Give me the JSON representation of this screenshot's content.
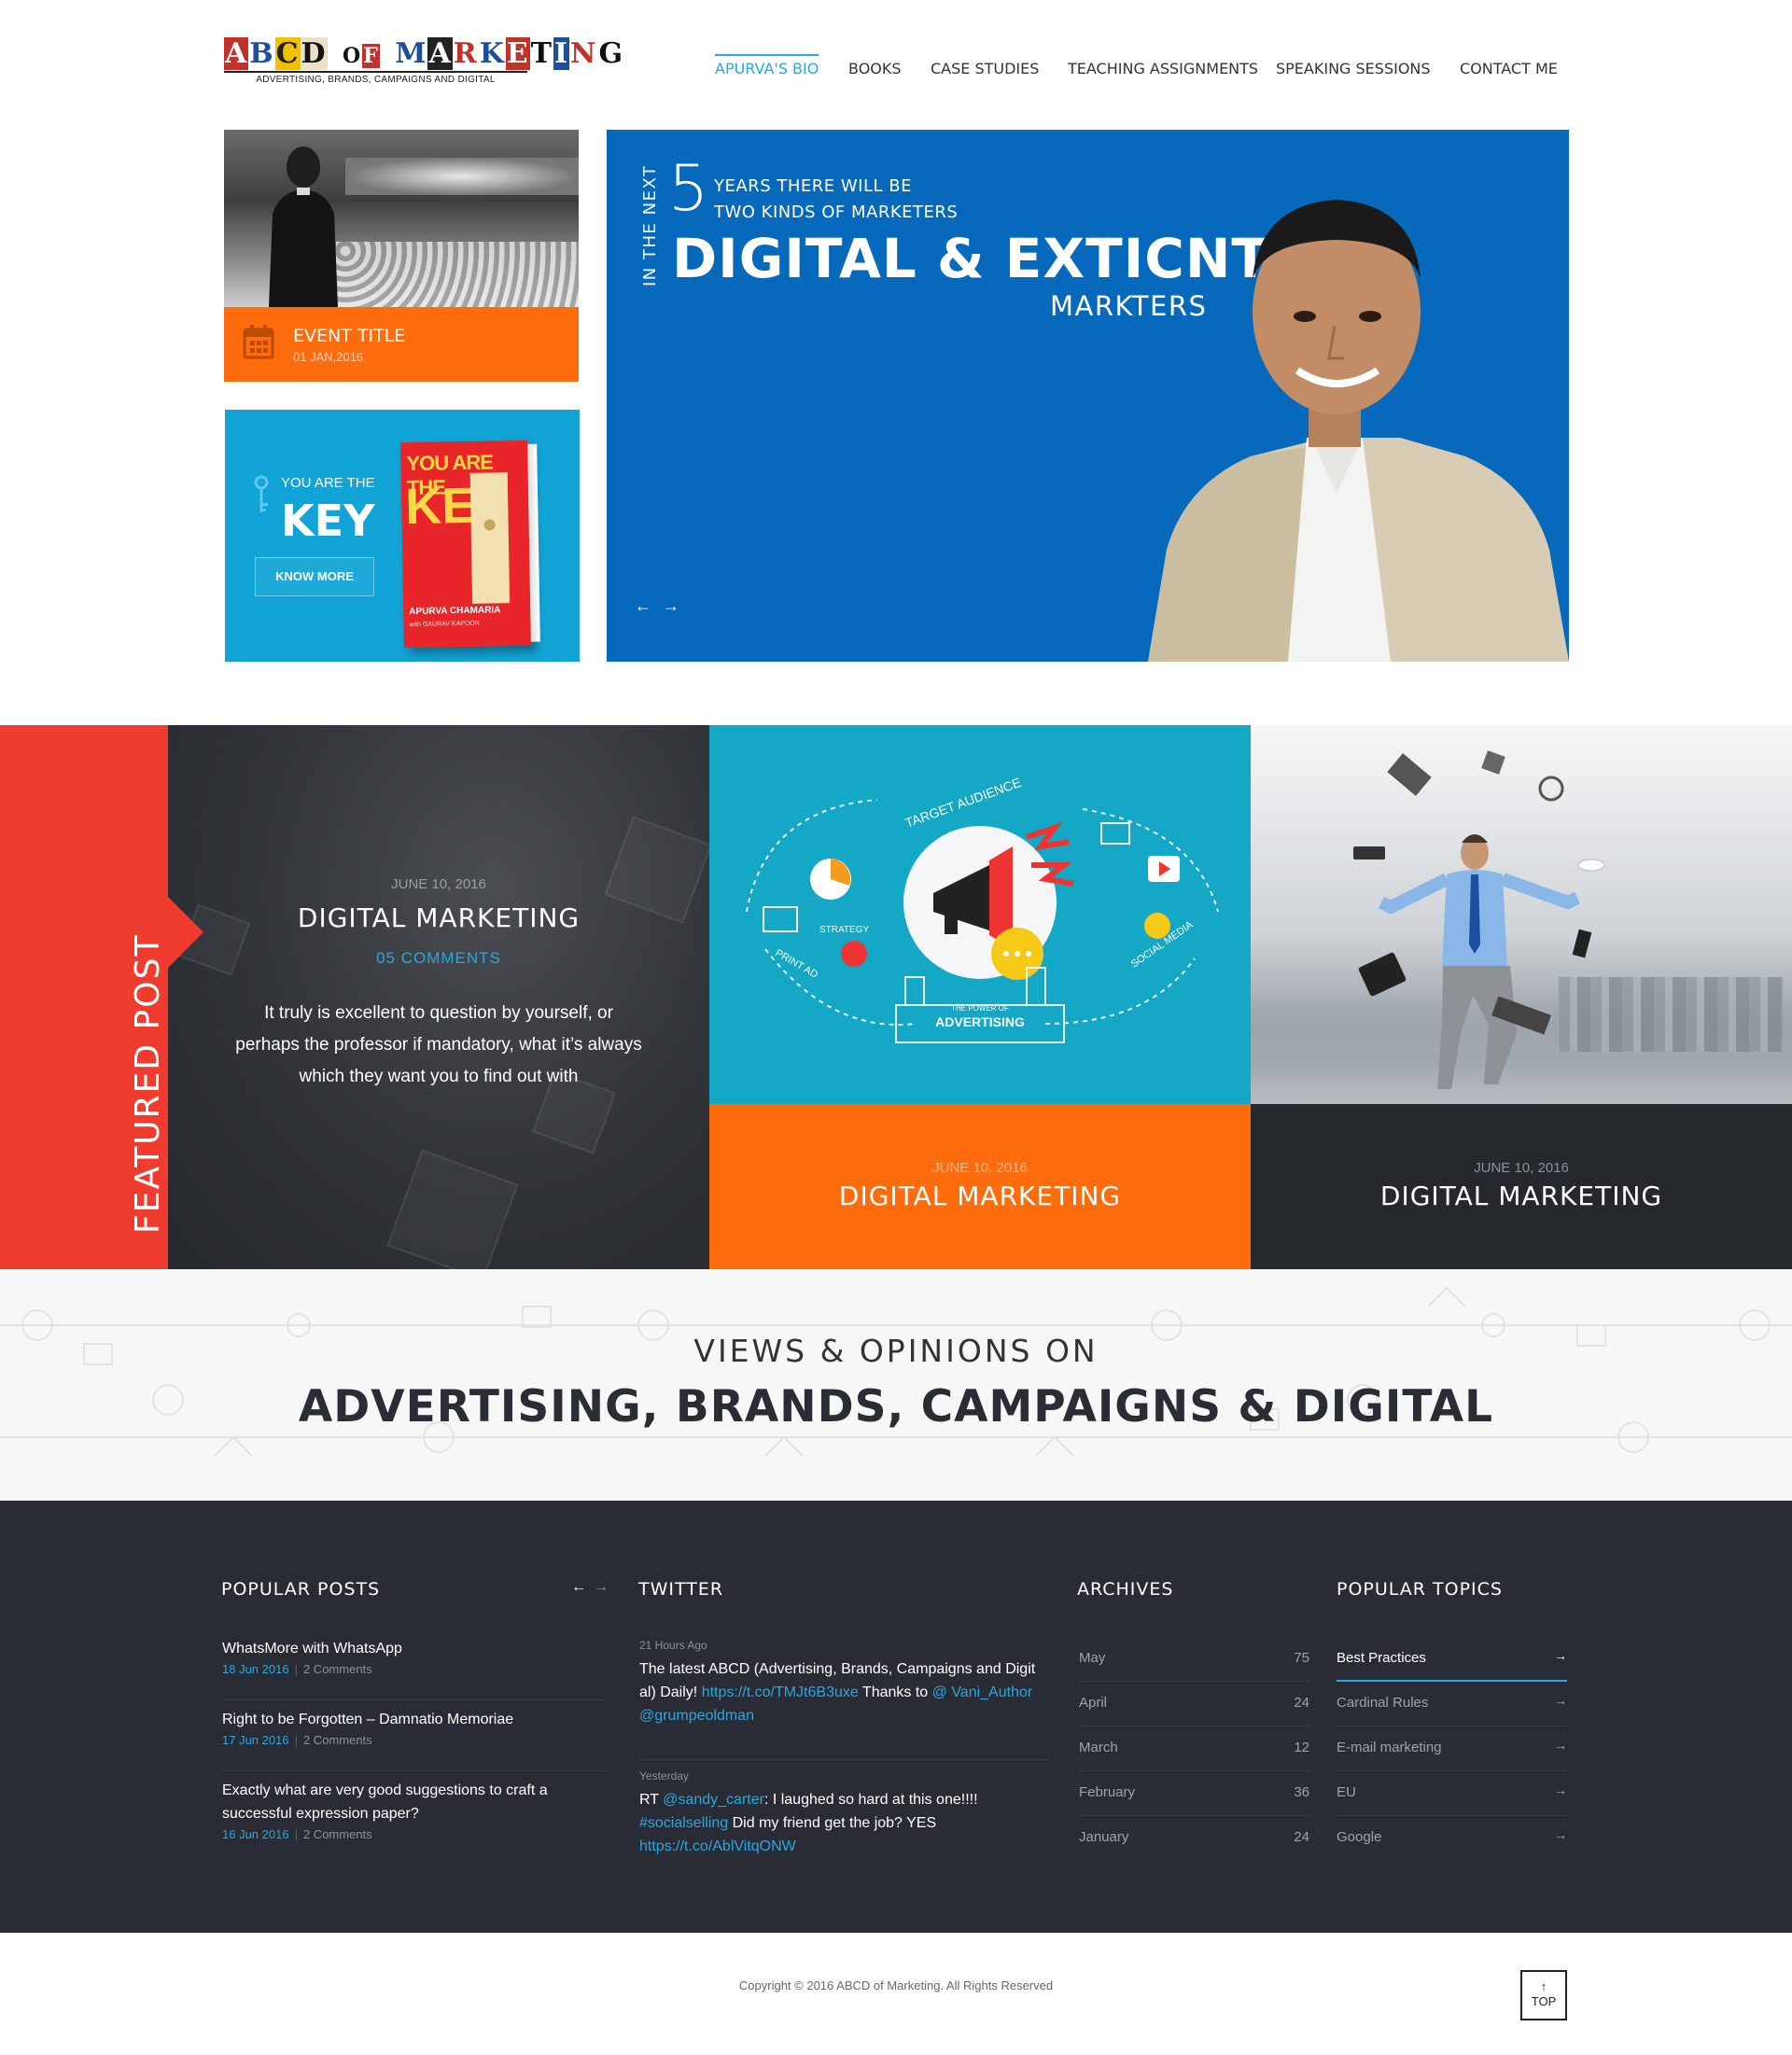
{
  "header": {
    "logo_text": "ABCD OF MARKETING",
    "logo_tagline": "ADVERTISING, BRANDS, CAMPAIGNS AND DIGITAL",
    "nav": [
      {
        "label": "APURVA'S BIO",
        "active": true
      },
      {
        "label": "BOOKS"
      },
      {
        "label": "CASE STUDIES"
      },
      {
        "label": "TEACHING ASSIGNMENTS"
      },
      {
        "label": "SPEAKING SESSIONS"
      },
      {
        "label": "CONTACT ME"
      }
    ]
  },
  "event": {
    "title": "EVENT TITLE",
    "date": "01 JAN,2016",
    "bar_color": "#ff6c0e"
  },
  "book": {
    "small": "YOU ARE THE",
    "big": "KEY",
    "button": "KNOW MORE",
    "cover_title_small": "YOU ARE THE",
    "cover_title_big": "KEY",
    "cover_author": "APURVA CHAMARIA",
    "cover_coauthor": "with GAURAV KAPOOR",
    "bg_color": "#12a4d6"
  },
  "hero": {
    "vertical": "IN THE NEXT",
    "number": "5",
    "line1": "YEARS THERE WILL BE",
    "line2": "TWO KINDS OF MARKETERS",
    "line3": "DIGITAL & EXTICNT",
    "line4": "MARKTERS",
    "prev_arrow": "←",
    "next_arrow": "→",
    "bg_color": "#0669bb"
  },
  "featured": {
    "tab_label": "FEATURED POST",
    "main": {
      "date": "JUNE 10, 2016",
      "title": "DIGITAL MARKETING",
      "comments": "05 COMMENTS",
      "excerpt": "It truly is excellent to question by yourself, or perhaps the professor if mandatory, what it’s always which they want you to find out with"
    },
    "ad_labels": [
      "TARGET AUDIENCE",
      "STRATEGY",
      "PRINT AD",
      "SOCIAL MEDIA",
      "THE POWER OF",
      "ADVERTISING"
    ],
    "post2": {
      "date": "JUNE 10, 2016",
      "title": "DIGITAL MARKETING"
    },
    "post3": {
      "date": "JUNE 10, 2016",
      "title": "DIGITAL MARKETING"
    }
  },
  "views": {
    "sub": "VIEWS & OPINIONS ON",
    "main": "ADVERTISING, BRANDS, CAMPAIGNS & DIGITAL"
  },
  "widgets": {
    "popular_title": "POPULAR POSTS",
    "popular_prev": "←",
    "popular_next": "→",
    "posts": [
      {
        "title": "WhatsMore with WhatsApp",
        "date": "18 Jun 2016",
        "comments": "2 Comments"
      },
      {
        "title": "Right to be Forgotten – Damnatio Memoriae",
        "date": "17 Jun 2016",
        "comments": "2 Comments"
      },
      {
        "title": "Exactly what are very good suggestions to craft a successful expression paper?",
        "date": "16 Jun 2016",
        "comments": "2 Comments"
      }
    ],
    "twitter_title": "TWITTER",
    "tweets": [
      {
        "time": "21 Hours Ago",
        "text_a": "The latest ABCD (Advertising, Brands, Campaigns and Digit al) Daily! ",
        "link1": "https://t.co/TMJt6B3uxe",
        "text_b": " Thanks to ",
        "link2": "@ Vani_Author @grumpeoldman"
      },
      {
        "time": "Yesterday",
        "text_a": "RT ",
        "link1": "@sandy_carter",
        "text_b": ": I laughed so hard at this one!!!! ",
        "link2": "#socialselling",
        "text_c": " Did my friend get the job? YES ",
        "link3": "https://t.co/AblVitqONW"
      }
    ],
    "archives_title": "ARCHIVES",
    "archives": [
      {
        "month": "May",
        "count": "75"
      },
      {
        "month": "April",
        "count": "24"
      },
      {
        "month": "March",
        "count": "12"
      },
      {
        "month": "February",
        "count": "36"
      },
      {
        "month": "January",
        "count": "24"
      }
    ],
    "topics_title": "POPULAR TOPICS",
    "topics": [
      {
        "name": "Best Practices",
        "active": true
      },
      {
        "name": "Cardinal Rules"
      },
      {
        "name": "E-mail marketing"
      },
      {
        "name": "EU"
      },
      {
        "name": "Google"
      }
    ],
    "topic_arrow": "→"
  },
  "footer": {
    "copyright": "Copyright © 2016 ABCD of Marketing. All Rights Reserved",
    "top_arrow": "↑",
    "top_label": "TOP"
  },
  "colors": {
    "accent": "#29a8e0",
    "orange": "#ff6c0e",
    "red": "#f03c2e",
    "dark": "#292c34",
    "hero_blue": "#0669bb"
  }
}
